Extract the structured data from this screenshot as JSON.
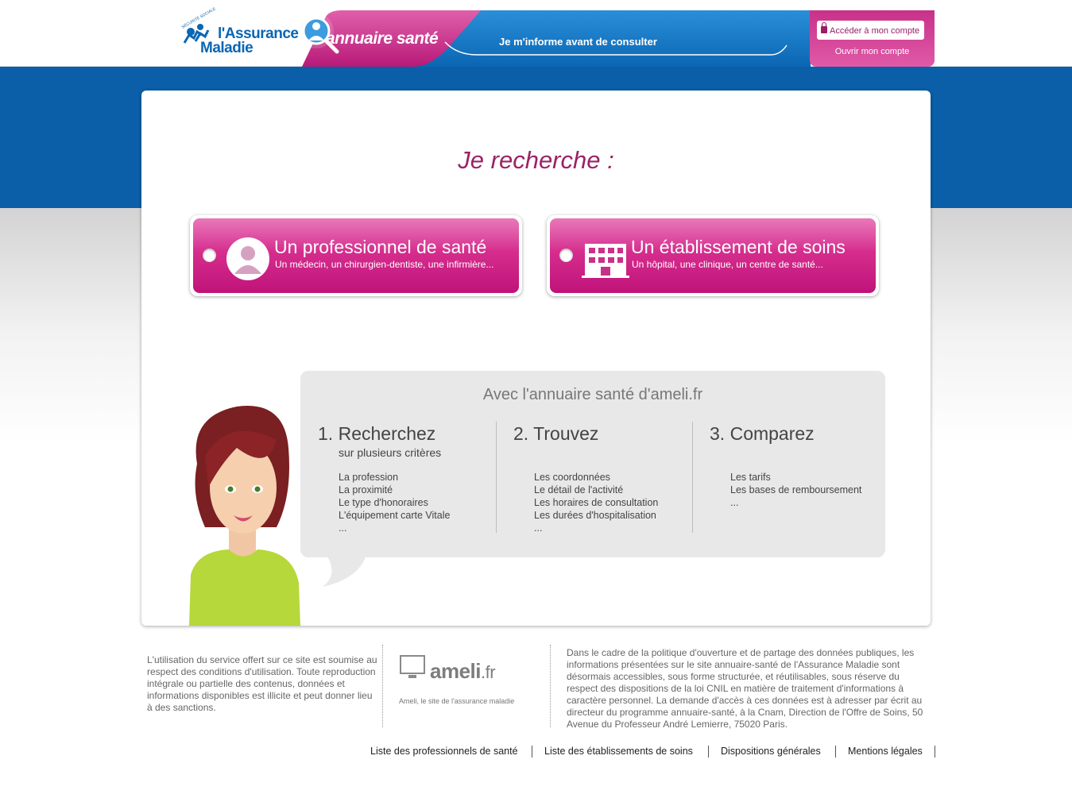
{
  "header": {
    "logo": {
      "small_text": "SÉCURITÉ SOCIALE",
      "line1": "l'Assurance",
      "line2": "Maladie"
    },
    "banner_title": "annuaire santé",
    "slogan": "Je m'informe avant de consulter",
    "account": {
      "access_label": "Accéder à mon compte",
      "open_label": "Ouvrir mon compte"
    }
  },
  "main": {
    "search_title": "Je recherche :",
    "choices": [
      {
        "title": "Un professionnel de santé",
        "subtitle": "Un médecin, un chirurgien-dentiste, une infirmière..."
      },
      {
        "title": "Un établissement de soins",
        "subtitle": "Un hôpital, une clinique, un centre de santé..."
      }
    ],
    "info": {
      "title": "Avec l'annuaire santé d'ameli.fr",
      "columns": [
        {
          "number": "1.",
          "heading": "Recherchez",
          "subheading": "sur plusieurs critères",
          "items": [
            "La profession",
            "La proximité",
            "Le type d'honoraires",
            "L'équipement carte Vitale",
            "..."
          ]
        },
        {
          "number": "2.",
          "heading": "Trouvez",
          "subheading": "",
          "items": [
            "Les coordonnées",
            "Le détail de l'activité",
            "Les horaires de consultation",
            "Les durées d'hospitalisation",
            "..."
          ]
        },
        {
          "number": "3.",
          "heading": "Comparez",
          "subheading": "",
          "items": [
            "Les tarifs",
            "Les bases de remboursement",
            "..."
          ]
        }
      ]
    }
  },
  "footer": {
    "left_text": "L'utilisation du service offert sur ce site est soumise au respect des conditions d'utilisation. Toute reproduction intégrale ou partielle des contenus, données et informations disponibles est illicite et peut donner lieu à des sanctions.",
    "ameli": {
      "name": "ameli",
      "suffix": ".fr",
      "tagline": "Ameli, le site de l'assurance maladie"
    },
    "right_text": "Dans le cadre de la politique d'ouverture et de partage des données publiques, les informations présentées sur le site annuaire-santé de l'Assurance Maladie sont désormais accessibles, sous forme structurée, et réutilisables, sous réserve du respect des dispositions de la loi CNIL en matière de traitement d'informations à caractère personnel. La demande d'accès à ces données est à adresser par écrit au directeur du programme annuaire-santé, à la Cnam, Direction de l'Offre de Soins, 50 Avenue du Professeur André Lemierre, 75020 Paris.",
    "links": [
      "Liste des professionnels de santé",
      "Liste des établissements de soins",
      "Dispositions générales",
      "Mentions légales"
    ]
  },
  "colors": {
    "brand_blue": "#0a5fa8",
    "magenta": "#c8318a",
    "title_purple": "#9b2266"
  }
}
